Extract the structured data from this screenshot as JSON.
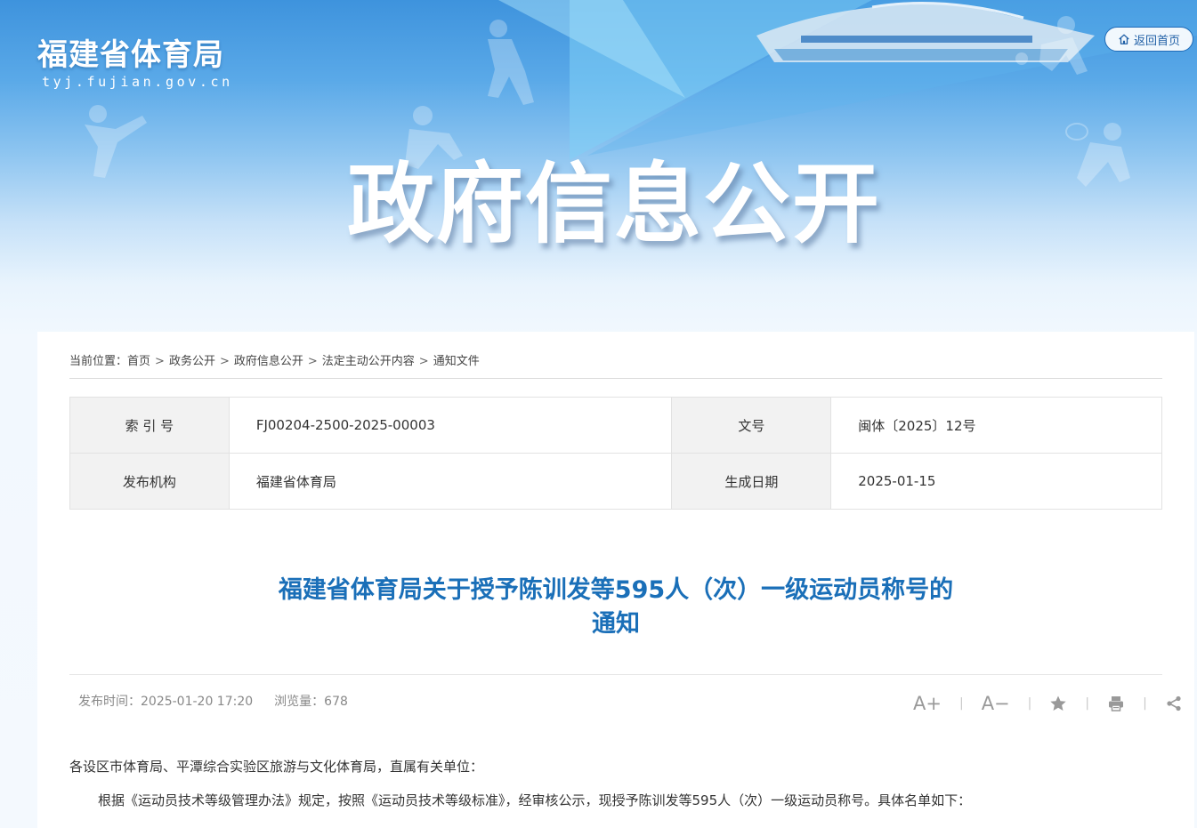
{
  "header": {
    "site_name": "福建省体育局",
    "site_domain": "tyj.fujian.gov.cn",
    "back_home_label": "返回首页",
    "hero_title": "政府信息公开"
  },
  "breadcrumb": {
    "prefix": "当前位置：",
    "items": [
      "首页",
      "政务公开",
      "政府信息公开",
      "法定主动公开内容",
      "通知文件"
    ],
    "separator": ">"
  },
  "meta": {
    "index_label": "索 引 号",
    "index_value": "FJ00204-2500-2025-00003",
    "doc_no_label": "文号",
    "doc_no_value": "闽体〔2025〕12号",
    "publisher_label": "发布机构",
    "publisher_value": "福建省体育局",
    "created_label": "生成日期",
    "created_value": "2025-01-15"
  },
  "article": {
    "title_line1": "福建省体育局关于授予陈训发等595人（次）一级运动员称号的",
    "title_line2": "通知",
    "publish_time_label": "发布时间：",
    "publish_time": "2025-01-20 17:20",
    "views_label": "浏览量：",
    "views": "678",
    "para1": "各设区市体育局、平潭综合实验区旅游与文化体育局，直属有关单位：",
    "para2": "根据《运动员技术等级管理办法》规定，按照《运动员技术等级标准》，经审核公示，现授予陈训发等595人（次）一级运动员称号。具体名单如下："
  },
  "tools": {
    "font_increase": "A+",
    "font_decrease": "A−",
    "separator": "|",
    "icons": [
      "star-icon",
      "print-icon",
      "share-icon"
    ]
  },
  "colors": {
    "title_blue": "#1a6fb8",
    "banner_blue": "#3e93dd",
    "label_bg": "#f2f2f2"
  }
}
